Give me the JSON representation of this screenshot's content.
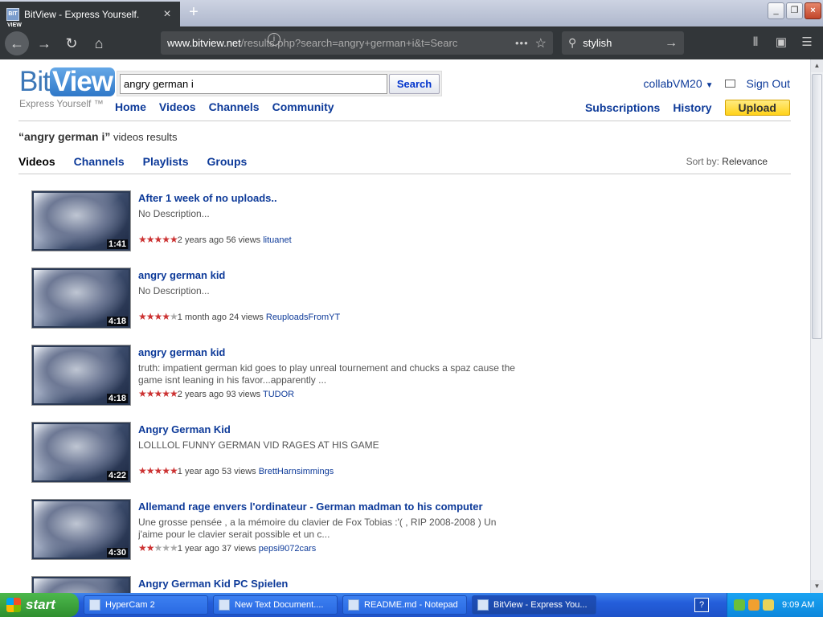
{
  "browser": {
    "tab_title": "BitView - Express Yourself.",
    "favicon_text": "BIT VIEW",
    "new_tab": "+",
    "url_domain": "www.bitview.net",
    "url_path": "/results.php?search=angry+german+i&t=Searc",
    "search_value": "stylish"
  },
  "site": {
    "logo_bit": "Bit",
    "logo_view": "View",
    "tagline": "Express Yourself ™",
    "search_value": "angry german i",
    "search_button": "Search",
    "nav": [
      "Home",
      "Videos",
      "Channels",
      "Community"
    ],
    "user": "collabVM20",
    "sign_out": "Sign Out",
    "subscriptions": "Subscriptions",
    "history": "History",
    "upload": "Upload"
  },
  "results": {
    "query": "“angry german i”",
    "suffix": " videos results",
    "tabs": [
      "Videos",
      "Channels",
      "Playlists",
      "Groups"
    ],
    "sort_label": "Sort by:",
    "sort_value": "Relevance",
    "items": [
      {
        "title": "After 1 week of no uploads..",
        "desc": "No Description...",
        "duration": "1:41",
        "rating": 4.5,
        "meta": "2 years ago 56 views",
        "author": "lituanet"
      },
      {
        "title": "angry german kid",
        "desc": "No Description...",
        "duration": "4:18",
        "rating": 4,
        "meta": "1 month ago 24 views",
        "author": "ReuploadsFromYT"
      },
      {
        "title": "angry german kid",
        "desc": "truth: impatient german kid goes to play unreal tournement and chucks a spaz cause the game isnt leaning in his favor...apparently ...",
        "duration": "4:18",
        "rating": 5,
        "meta": "2 years ago 93 views",
        "author": "TUDOR"
      },
      {
        "title": "Angry German Kid",
        "desc": "LOLLLOL FUNNY GERMAN VID RAGES AT HIS GAME",
        "duration": "4:22",
        "rating": 5,
        "meta": "1 year ago 53 views",
        "author": "BrettHarnsimmings"
      },
      {
        "title": "Allemand rage envers l'ordinateur - German madman to his computer",
        "desc": "Une grosse pensée , a la mémoire du clavier de Fox Tobias :'( , RIP 2008-2008 ) Un j'aime pour le clavier serait possible et un c...",
        "duration": "4:30",
        "rating": 2,
        "meta": "1 year ago 37 views",
        "author": "pepsi9072cars"
      },
      {
        "title": "Angry German Kid PC Spielen",
        "desc": "",
        "duration": "",
        "rating": 0,
        "meta": "",
        "author": ""
      }
    ]
  },
  "taskbar": {
    "start": "start",
    "tasks": [
      "HyperCam 2",
      "New Text Document....",
      "README.md - Notepad",
      "BitView - Express You..."
    ],
    "help": "?",
    "clock": "9:09 AM"
  },
  "colors": {
    "link": "#0d3a99",
    "upload": "#ffd21a",
    "stars": "#cc3333"
  }
}
